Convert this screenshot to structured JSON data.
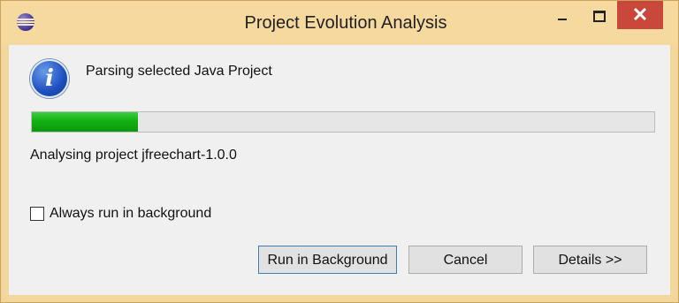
{
  "window": {
    "title": "Project Evolution Analysis",
    "close_symbol": "✕"
  },
  "icons": {
    "app": "eclipse-icon",
    "info": "info-icon",
    "info_glyph": "i"
  },
  "main": {
    "message": "Parsing selected Java Project",
    "progress_fraction": 0.17,
    "status": "Analysing project jfreechart-1.0.0"
  },
  "options": {
    "always_background_label": "Always run in background",
    "always_background_checked": false
  },
  "buttons": {
    "run_in_background": "Run in Background",
    "cancel": "Cancel",
    "details": "Details >>"
  },
  "colors": {
    "progress": "#13b013",
    "close_button": "#c9483b",
    "frame": "#f6d99f"
  }
}
